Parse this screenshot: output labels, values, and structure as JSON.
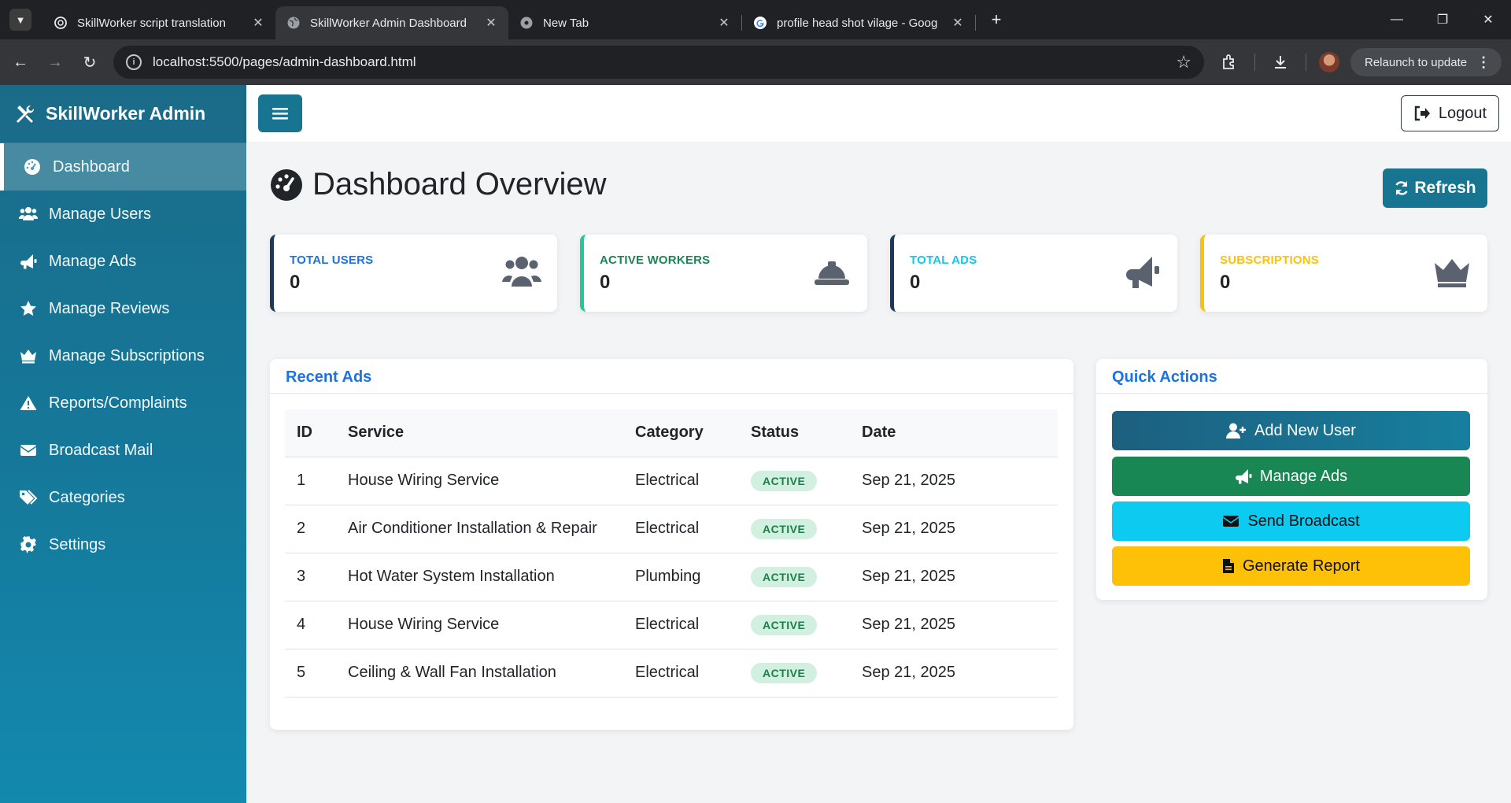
{
  "browser": {
    "tabs": [
      {
        "title": "SkillWorker script translation",
        "icon": "openai-icon",
        "active": false
      },
      {
        "title": "SkillWorker Admin Dashboard",
        "icon": "globe-icon",
        "active": true
      },
      {
        "title": "New Tab",
        "icon": "chrome-icon",
        "active": false
      },
      {
        "title": "profile head shot vilage - Goog",
        "icon": "google-icon",
        "active": false
      }
    ],
    "url": "localhost:5500/pages/admin-dashboard.html",
    "relaunch_label": "Relaunch to update"
  },
  "sidebar": {
    "brand": "SkillWorker Admin",
    "items": [
      {
        "label": "Dashboard",
        "icon": "gauge-icon",
        "active": true
      },
      {
        "label": "Manage Users",
        "icon": "users-icon"
      },
      {
        "label": "Manage Ads",
        "icon": "megaphone-icon"
      },
      {
        "label": "Manage Reviews",
        "icon": "star-icon"
      },
      {
        "label": "Manage Subscriptions",
        "icon": "crown-icon"
      },
      {
        "label": "Reports/Complaints",
        "icon": "warning-icon"
      },
      {
        "label": "Broadcast Mail",
        "icon": "envelope-icon"
      },
      {
        "label": "Categories",
        "icon": "tags-icon"
      },
      {
        "label": "Settings",
        "icon": "gear-icon"
      }
    ]
  },
  "topbar": {
    "logout_label": "Logout"
  },
  "main": {
    "title": "Dashboard Overview",
    "refresh_label": "Refresh",
    "stats": [
      {
        "label": "TOTAL USERS",
        "value": "0",
        "color": "#1a73e8",
        "border": "#1d3a5c",
        "icon": "users-icon"
      },
      {
        "label": "ACTIVE WORKERS",
        "value": "0",
        "color": "#198754",
        "border": "#20c997",
        "icon": "hard-hat-icon"
      },
      {
        "label": "TOTAL ADS",
        "value": "0",
        "color": "#0dcaf0",
        "border": "#1d3a5c",
        "icon": "megaphone-icon"
      },
      {
        "label": "SUBSCRIPTIONS",
        "value": "0",
        "color": "#ffc107",
        "border": "#ffc107",
        "icon": "crown-icon"
      }
    ],
    "recent_ads": {
      "title": "Recent Ads",
      "columns": [
        "ID",
        "Service",
        "Category",
        "Status",
        "Date"
      ],
      "rows": [
        {
          "id": "1",
          "service": "House Wiring Service",
          "category": "Electrical",
          "status": "ACTIVE",
          "date": "Sep 21, 2025"
        },
        {
          "id": "2",
          "service": "Air Conditioner Installation & Repair",
          "category": "Electrical",
          "status": "ACTIVE",
          "date": "Sep 21, 2025"
        },
        {
          "id": "3",
          "service": "Hot Water System Installation",
          "category": "Plumbing",
          "status": "ACTIVE",
          "date": "Sep 21, 2025"
        },
        {
          "id": "4",
          "service": "House Wiring Service",
          "category": "Electrical",
          "status": "ACTIVE",
          "date": "Sep 21, 2025"
        },
        {
          "id": "5",
          "service": "Ceiling & Wall Fan Installation",
          "category": "Electrical",
          "status": "ACTIVE",
          "date": "Sep 21, 2025"
        }
      ]
    },
    "quick_actions": {
      "title": "Quick Actions",
      "buttons": [
        {
          "label": "Add New User",
          "icon": "user-plus-icon",
          "color": "#177592"
        },
        {
          "label": "Manage Ads",
          "icon": "megaphone-icon",
          "color": "#198754"
        },
        {
          "label": "Send Broadcast",
          "icon": "envelope-icon",
          "color": "#0dcaf0"
        },
        {
          "label": "Generate Report",
          "icon": "file-icon",
          "color": "#ffc107"
        }
      ]
    }
  }
}
